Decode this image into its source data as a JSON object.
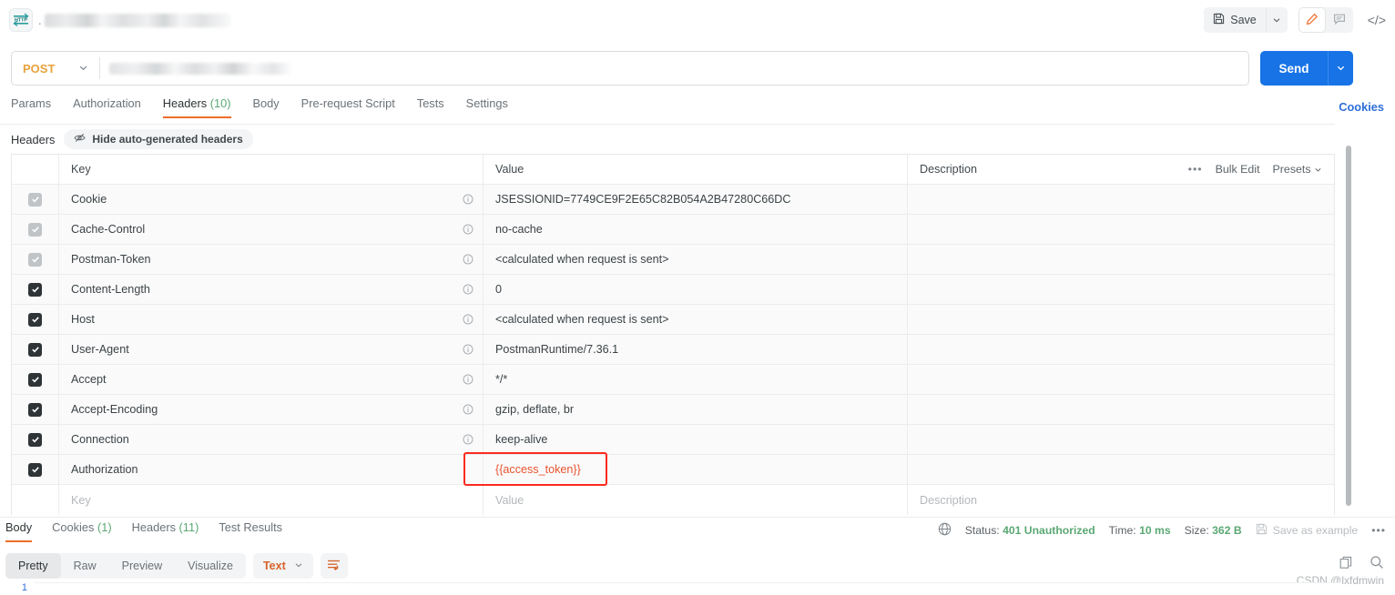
{
  "topbar": {
    "tab_icon": "http-protocol-icon",
    "tab_dot": ".",
    "save_label": "Save",
    "save_icon": "floppy-disk-icon",
    "save_caret_icon": "chevron-down-icon",
    "edit_icon": "pencil-icon",
    "comment_icon": "comment-icon",
    "code_icon": "</>"
  },
  "request": {
    "method": "POST",
    "method_caret": "chevron-down-icon",
    "send_label": "Send",
    "send_caret": "chevron-down-icon"
  },
  "request_tabs": [
    {
      "label": "Params",
      "count": "",
      "active": false
    },
    {
      "label": "Authorization",
      "count": "",
      "active": false
    },
    {
      "label": "Headers",
      "count": "(10)",
      "active": true
    },
    {
      "label": "Body",
      "count": "",
      "active": false
    },
    {
      "label": "Pre-request Script",
      "count": "",
      "active": false
    },
    {
      "label": "Tests",
      "count": "",
      "active": false
    },
    {
      "label": "Settings",
      "count": "",
      "active": false
    }
  ],
  "cookies_link": "Cookies",
  "headers_section": {
    "label": "Headers",
    "toggle_label": "Hide auto-generated headers",
    "toggle_icon": "eye-slash-icon"
  },
  "table": {
    "columns": {
      "key": "Key",
      "value": "Value",
      "description": "Description"
    },
    "actions": {
      "more": "•••",
      "bulk_edit": "Bulk Edit",
      "presets": "Presets",
      "presets_caret": "chevron-down-icon"
    },
    "rows": [
      {
        "checked": true,
        "dim": true,
        "key": "Cookie",
        "value": "JSESSIONID=7749CE9F2E65C82B054A2B47280C66DC",
        "description": ""
      },
      {
        "checked": true,
        "dim": true,
        "key": "Cache-Control",
        "value": "no-cache",
        "description": ""
      },
      {
        "checked": true,
        "dim": true,
        "key": "Postman-Token",
        "value": "<calculated when request is sent>",
        "description": ""
      },
      {
        "checked": true,
        "dim": false,
        "key": "Content-Length",
        "value": "0",
        "description": ""
      },
      {
        "checked": true,
        "dim": false,
        "key": "Host",
        "value": "<calculated when request is sent>",
        "description": ""
      },
      {
        "checked": true,
        "dim": false,
        "key": "User-Agent",
        "value": "PostmanRuntime/7.36.1",
        "description": ""
      },
      {
        "checked": true,
        "dim": false,
        "key": "Accept",
        "value": "*/*",
        "description": ""
      },
      {
        "checked": true,
        "dim": false,
        "key": "Accept-Encoding",
        "value": "gzip, deflate, br",
        "description": ""
      },
      {
        "checked": true,
        "dim": false,
        "key": "Connection",
        "value": "keep-alive",
        "description": ""
      },
      {
        "checked": true,
        "dim": false,
        "key": "Authorization",
        "value": "{{access_token}}",
        "description": "",
        "highlight": true
      }
    ],
    "placeholder": {
      "key": "Key",
      "value": "Value",
      "description": "Description"
    }
  },
  "response_tabs": [
    {
      "label": "Body",
      "count": "",
      "active": true
    },
    {
      "label": "Cookies",
      "count": "(1)",
      "active": false
    },
    {
      "label": "Headers",
      "count": "(11)",
      "active": false
    },
    {
      "label": "Test Results",
      "count": "",
      "active": false
    }
  ],
  "status": {
    "globe_icon": "globe-icon",
    "status_label": "Status:",
    "status_value": "401 Unauthorized",
    "time_label": "Time:",
    "time_value": "10 ms",
    "size_label": "Size:",
    "size_value": "362 B",
    "save_example": "Save as example",
    "save_example_icon": "floppy-disk-icon",
    "more_icon": "•••"
  },
  "view_modes": [
    {
      "label": "Pretty",
      "active": true
    },
    {
      "label": "Raw",
      "active": false
    },
    {
      "label": "Preview",
      "active": false
    },
    {
      "label": "Visualize",
      "active": false
    }
  ],
  "format_select": {
    "label": "Text",
    "caret": "chevron-down-icon"
  },
  "wrap_icon": "wrap-lines-icon",
  "bottom_right": {
    "copy_icon": "copy-icon",
    "search_icon": "search-icon"
  },
  "watermark": "CSDN @lxfdmwin",
  "editor": {
    "line_number": "1"
  },
  "colors": {
    "accent_orange": "#ef6c2c",
    "send_blue": "#1773e6",
    "link_blue": "#2f6fd8",
    "status_green": "#5aa873",
    "method_orange": "#e8a33d",
    "annotation_red": "#fc2a1e",
    "token_red": "#e8552f"
  }
}
